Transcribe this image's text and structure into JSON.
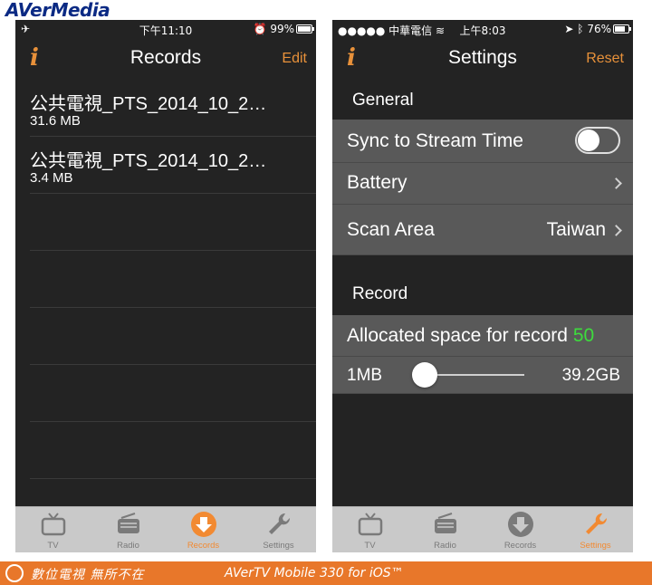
{
  "brand": {
    "logo_text": "AVerMedia"
  },
  "left_phone": {
    "status": {
      "time": "下午11:10",
      "battery": "99%",
      "battery_level": 0.99
    },
    "nav": {
      "title": "Records",
      "action": "Edit"
    },
    "records": [
      {
        "name": "公共電視_PTS_2014_10_2…",
        "size": "31.6 MB"
      },
      {
        "name": "公共電視_PTS_2014_10_2…",
        "size": "3.4 MB"
      }
    ]
  },
  "right_phone": {
    "status": {
      "carrier": "●●●●● 中華電信",
      "time": "上午8:03",
      "battery": "76%",
      "battery_level": 0.76
    },
    "nav": {
      "title": "Settings",
      "action": "Reset"
    },
    "general": {
      "header": "General",
      "sync_label": "Sync to Stream Time",
      "sync_on": false,
      "battery_label": "Battery",
      "scan_label": "Scan Area",
      "scan_value": "Taiwan"
    },
    "record": {
      "header": "Record",
      "allocated_label": "Allocated space for record",
      "allocated_value": "50",
      "slider_min": "1MB",
      "slider_max": "39.2GB",
      "slider_level": 0.1
    }
  },
  "tabs": [
    {
      "label": "TV",
      "icon": "tv-icon"
    },
    {
      "label": "Radio",
      "icon": "radio-icon"
    },
    {
      "label": "Records",
      "icon": "records-download-icon"
    },
    {
      "label": "Settings",
      "icon": "wrench-icon"
    }
  ],
  "footer": {
    "slogan": "數位電視 無所不在",
    "product": "AVerTV Mobile 330 for iOS™"
  },
  "colors": {
    "accent": "#e8913a",
    "footer": "#e8772a",
    "allocated_value": "#3ddc3d"
  }
}
